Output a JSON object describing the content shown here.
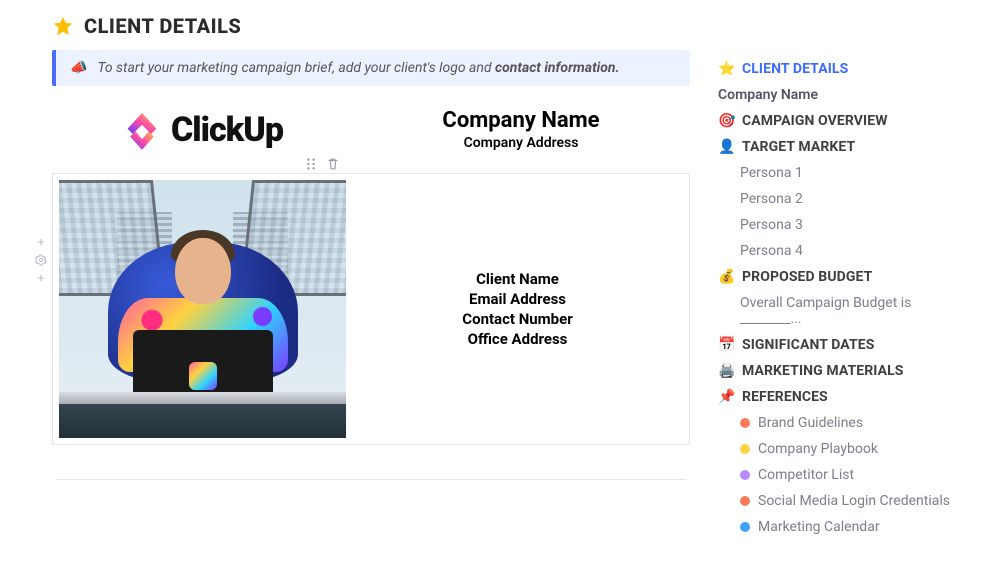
{
  "page": {
    "title": "CLIENT DETAILS"
  },
  "banner": {
    "prefix": "To start your marketing campaign brief, add your client's logo and ",
    "bold": "contact information."
  },
  "company": {
    "logo_word": "ClickUp",
    "name": "Company Name",
    "address": "Company Address"
  },
  "client": {
    "name": "Client Name",
    "email": "Email Address",
    "phone": "Contact Number",
    "office": "Office Address"
  },
  "outline": {
    "items": [
      {
        "emoji": "⭐",
        "label": "CLIENT DETAILS",
        "active": true
      },
      {
        "plain": "Company Name"
      },
      {
        "emoji": "🎯",
        "label": "CAMPAIGN OVERVIEW"
      },
      {
        "emoji": "👤",
        "label": "TARGET MARKET",
        "subs": [
          "Persona 1",
          "Persona 2",
          "Persona 3",
          "Persona 4"
        ]
      },
      {
        "emoji": "💰",
        "label": "PROPOSED BUDGET",
        "subs": [
          "Overall Campaign Budget is ________..."
        ]
      },
      {
        "emoji": "📅",
        "label": "SIGNIFICANT DATES"
      },
      {
        "emoji": "🖨️",
        "label": "MARKETING MATERIALS"
      },
      {
        "emoji": "📌",
        "label": "REFERENCES",
        "pills": [
          {
            "color": "#ff7a59",
            "label": "Brand Guidelines"
          },
          {
            "color": "#ffd23f",
            "label": "Company Playbook"
          },
          {
            "color": "#b78cff",
            "label": "Competitor List"
          },
          {
            "color": "#ff7a59",
            "label": "Social Media Login Credentials"
          },
          {
            "color": "#3ea2ff",
            "label": "Marketing Calendar"
          }
        ]
      }
    ]
  }
}
